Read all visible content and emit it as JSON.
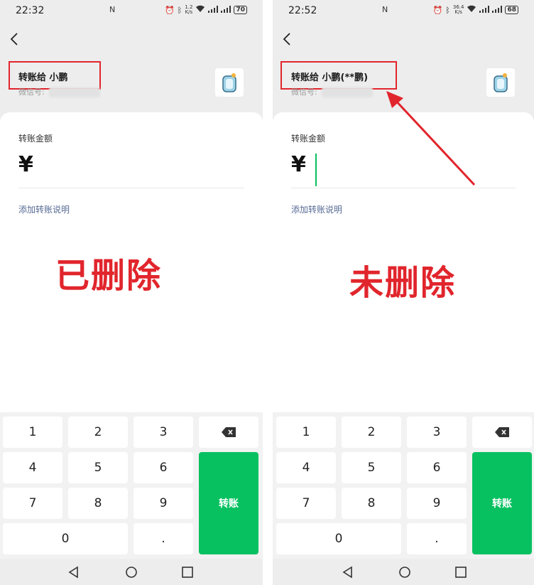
{
  "left_screen": {
    "status": {
      "time": "22:32",
      "nfc": "N",
      "speed_top": "1.2",
      "speed_bottom": "K/s",
      "battery": "70"
    },
    "payee": {
      "name": "转账给 小鹏",
      "wechat_label": "微信号:"
    },
    "amount_label": "转账金额",
    "currency_symbol": "¥",
    "add_note": "添加转账说明",
    "overlay_label": "已删除",
    "keypad": {
      "k1": "1",
      "k2": "2",
      "k3": "3",
      "k4": "4",
      "k5": "5",
      "k6": "6",
      "k7": "7",
      "k8": "8",
      "k9": "9",
      "k0": "0",
      "kdot": ".",
      "transfer": "转账"
    }
  },
  "right_screen": {
    "status": {
      "time": "22:52",
      "nfc": "N",
      "speed_top": "36.4",
      "speed_bottom": "K/s",
      "battery": "68"
    },
    "payee": {
      "name": "转账给 小鹏(**鹏)",
      "wechat_label": "微信号:"
    },
    "amount_label": "转账金额",
    "currency_symbol": "¥",
    "add_note": "添加转账说明",
    "overlay_label": "未删除",
    "keypad": {
      "k1": "1",
      "k2": "2",
      "k3": "3",
      "k4": "4",
      "k5": "5",
      "k6": "6",
      "k7": "7",
      "k8": "8",
      "k9": "9",
      "k0": "0",
      "kdot": ".",
      "transfer": "转账"
    }
  },
  "colors": {
    "accent_green": "#07c160",
    "annotation_red": "#e1252c",
    "link_blue": "#576b95"
  },
  "icons": [
    "back-arrow-icon",
    "alarm-icon",
    "bluetooth-icon",
    "wifi-icon",
    "signal-icon",
    "battery-icon",
    "backspace-icon",
    "nav-back-icon",
    "nav-home-icon",
    "nav-recents-icon",
    "avatar-icon"
  ]
}
